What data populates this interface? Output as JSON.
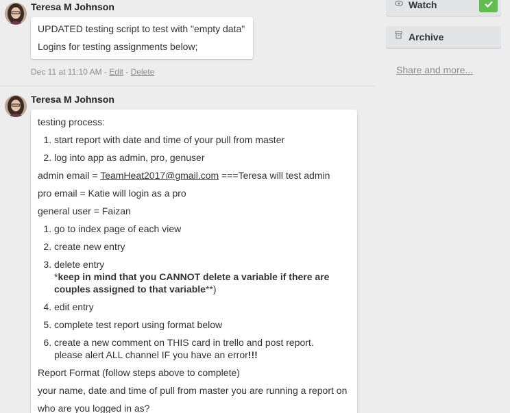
{
  "sidebar": {
    "watch_label": "Watch",
    "archive_label": "Archive",
    "share_label": "Share and more..."
  },
  "comments": [
    {
      "author": "Teresa M Johnson",
      "lines": [
        "UPDATED testing script to test with \"empty data\"",
        "Logins for testing assignments below;"
      ],
      "timestamp": "Dec 11 at 11:10 AM",
      "sep1": " - ",
      "edit_label": "Edit",
      "sep2": " - ",
      "delete_label": "Delete"
    },
    {
      "author": "Teresa M Johnson",
      "intro": "testing process:",
      "steps_a": [
        "start report with date and time of your pull from master",
        "log into app as admin, pro, genuser"
      ],
      "admin_prefix": "admin email = ",
      "admin_email": "TeamHeat2017@gmail.com",
      "admin_suffix": " ===Teresa will test admin",
      "pro_line": "pro email = Katie will login as a pro",
      "general_line": "general user = Faizan",
      "steps_b": [
        "go to index page of each view",
        "create new entry",
        "delete entry",
        "edit entry",
        "complete test report using format below",
        "create a new comment on THIS card in trello and post report."
      ],
      "step3_note_prefix": "*",
      "step3_note_bold": "keep in mind that you CANNOT delete a variable if there are couples assigned to that variable",
      "step3_note_suffix": "**)",
      "step6_note": "please alert ALL channel IF you have an error",
      "step6_note_bang": "!!!",
      "report_format": "Report Format (follow steps above to complete)",
      "report_line1": "your name, date and time of pull from master you are running a report on",
      "report_line2": "who are you logged in as?"
    }
  ],
  "colors": {
    "background": "#ededed",
    "watch_check": "#61bd4f"
  }
}
